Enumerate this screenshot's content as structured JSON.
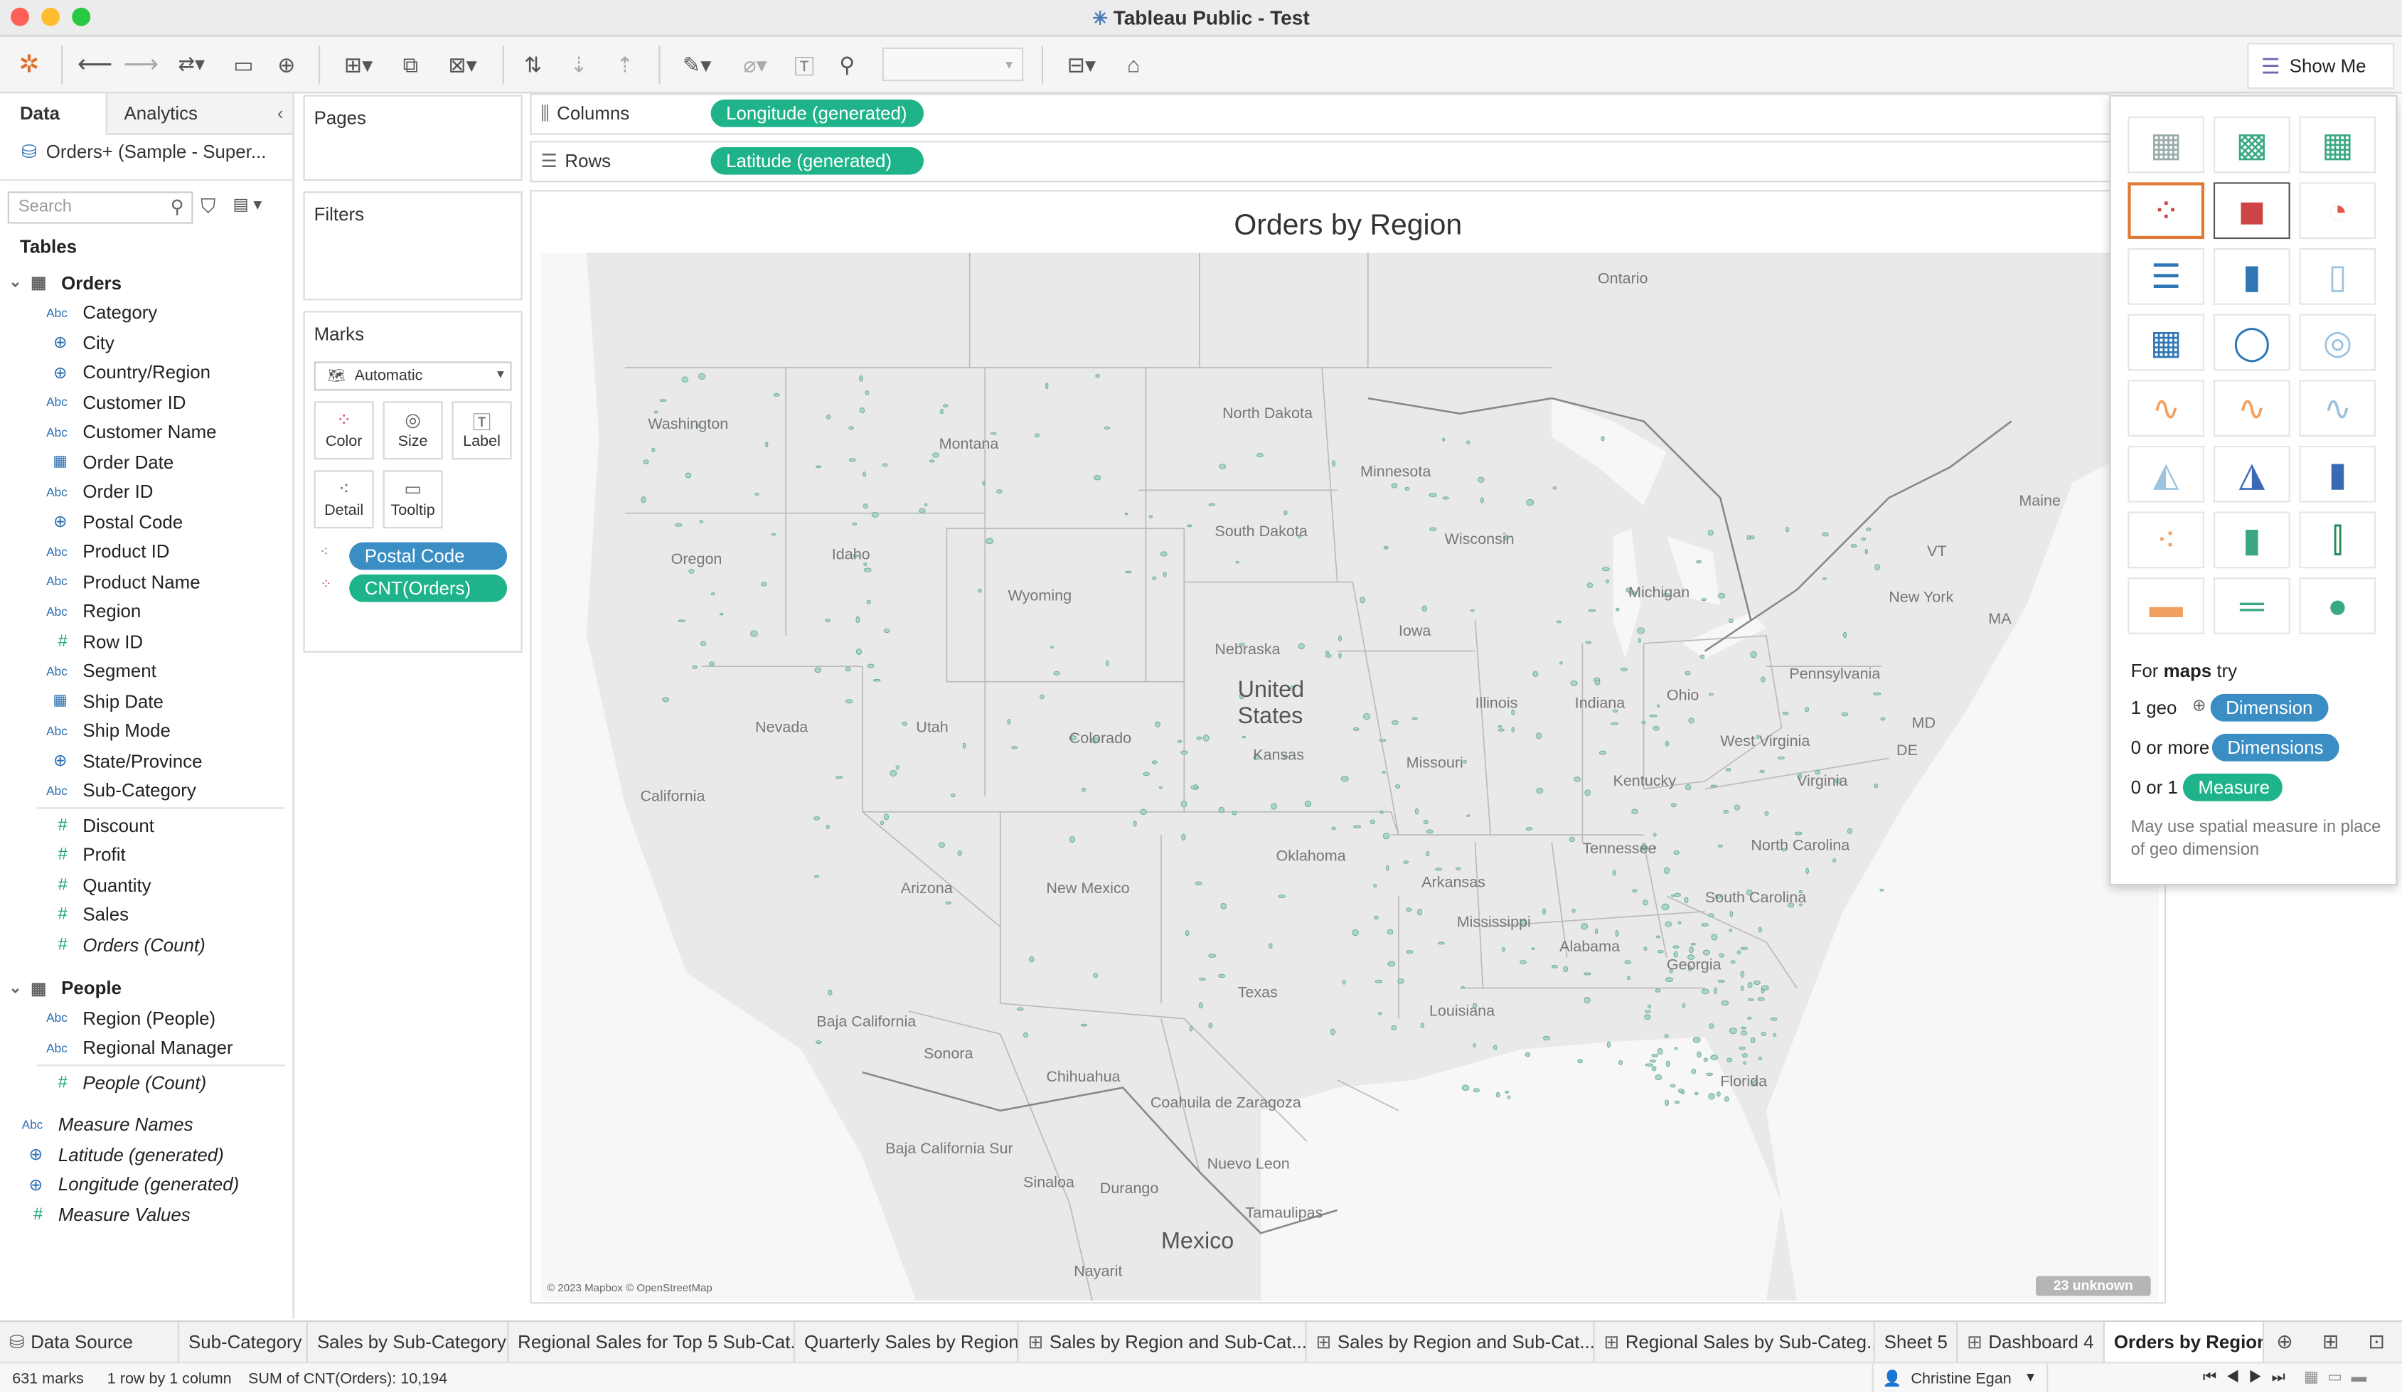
{
  "window": {
    "title": "Tableau Public - Test"
  },
  "toolbar": {
    "show_me_label": "Show Me"
  },
  "data_pane": {
    "tabs": [
      "Data",
      "Analytics"
    ],
    "datasource": "Orders+ (Sample - Super...",
    "search_placeholder": "Search",
    "tables_header": "Tables",
    "orders_table": "Orders",
    "orders_fields": [
      {
        "name": "Category",
        "type": "abc"
      },
      {
        "name": "City",
        "type": "geo"
      },
      {
        "name": "Country/Region",
        "type": "geo"
      },
      {
        "name": "Customer ID",
        "type": "abc"
      },
      {
        "name": "Customer Name",
        "type": "abc"
      },
      {
        "name": "Order Date",
        "type": "date"
      },
      {
        "name": "Order ID",
        "type": "abc"
      },
      {
        "name": "Postal Code",
        "type": "geo"
      },
      {
        "name": "Product ID",
        "type": "abc"
      },
      {
        "name": "Product Name",
        "type": "abc"
      },
      {
        "name": "Region",
        "type": "abc"
      },
      {
        "name": "Row ID",
        "type": "num"
      },
      {
        "name": "Segment",
        "type": "abc"
      },
      {
        "name": "Ship Date",
        "type": "date"
      },
      {
        "name": "Ship Mode",
        "type": "abc"
      },
      {
        "name": "State/Province",
        "type": "geo"
      },
      {
        "name": "Sub-Category",
        "type": "abc"
      }
    ],
    "orders_measures": [
      {
        "name": "Discount",
        "type": "num"
      },
      {
        "name": "Profit",
        "type": "num"
      },
      {
        "name": "Quantity",
        "type": "num"
      },
      {
        "name": "Sales",
        "type": "num"
      },
      {
        "name": "Orders (Count)",
        "type": "num",
        "italic": true
      }
    ],
    "people_table": "People",
    "people_fields": [
      {
        "name": "Region (People)",
        "type": "abc"
      },
      {
        "name": "Regional Manager",
        "type": "abc"
      }
    ],
    "people_measures": [
      {
        "name": "People (Count)",
        "type": "num",
        "italic": true
      }
    ],
    "generated_fields": [
      {
        "name": "Measure Names",
        "type": "abc",
        "italic": true
      },
      {
        "name": "Latitude (generated)",
        "type": "geo",
        "italic": true
      },
      {
        "name": "Longitude (generated)",
        "type": "geo",
        "italic": true
      },
      {
        "name": "Measure Values",
        "type": "num",
        "italic": true
      }
    ]
  },
  "cards": {
    "pages": "Pages",
    "filters": "Filters",
    "marks": "Marks",
    "mark_type": "Automatic",
    "mark_buttons": [
      "Color",
      "Size",
      "Label",
      "Detail",
      "Tooltip"
    ],
    "mark_pills": [
      "Postal Code",
      "CNT(Orders)"
    ]
  },
  "shelves": {
    "columns_label": "Columns",
    "columns_pill": "Longitude (generated)",
    "rows_label": "Rows",
    "rows_pill": "Latitude (generated)"
  },
  "view": {
    "title": "Orders by Region",
    "attribution": "© 2023 Mapbox © OpenStreetMap",
    "unknown_badge": "23 unknown",
    "map_labels": [
      {
        "t": "Ontario"
      },
      {
        "t": "Washington"
      },
      {
        "t": "Montana"
      },
      {
        "t": "North Dakota"
      },
      {
        "t": "Minnesota"
      },
      {
        "t": "Maine"
      },
      {
        "t": "South Dakota"
      },
      {
        "t": "Wisconsin"
      },
      {
        "t": "Oregon"
      },
      {
        "t": "Idaho"
      },
      {
        "t": "Wyoming"
      },
      {
        "t": "Michigan"
      },
      {
        "t": "VT"
      },
      {
        "t": "New York"
      },
      {
        "t": "MA"
      },
      {
        "t": "Iowa"
      },
      {
        "t": "Nebraska"
      },
      {
        "t": "Pennsylvania"
      },
      {
        "t": "United States"
      },
      {
        "t": "Illinois"
      },
      {
        "t": "Indiana"
      },
      {
        "t": "Ohio"
      },
      {
        "t": "Nevada"
      },
      {
        "t": "Utah"
      },
      {
        "t": "Colorado"
      },
      {
        "t": "Kansas"
      },
      {
        "t": "MD"
      },
      {
        "t": "West Virginia"
      },
      {
        "t": "DE"
      },
      {
        "t": "Missouri"
      },
      {
        "t": "Virginia"
      },
      {
        "t": "Kentucky"
      },
      {
        "t": "California"
      },
      {
        "t": "Tennessee"
      },
      {
        "t": "North Carolina"
      },
      {
        "t": "Oklahoma"
      },
      {
        "t": "Arizona"
      },
      {
        "t": "New Mexico"
      },
      {
        "t": "Arkansas"
      },
      {
        "t": "South Carolina"
      },
      {
        "t": "Mississippi"
      },
      {
        "t": "Alabama"
      },
      {
        "t": "Georgia"
      },
      {
        "t": "Texas"
      },
      {
        "t": "Louisiana"
      },
      {
        "t": "Baja California"
      },
      {
        "t": "Sonora"
      },
      {
        "t": "Chihuahua"
      },
      {
        "t": "Florida"
      },
      {
        "t": "Coahuila de Zaragoza"
      },
      {
        "t": "Baja California Sur"
      },
      {
        "t": "Nuevo Leon"
      },
      {
        "t": "Sinaloa"
      },
      {
        "t": "Durango"
      },
      {
        "t": "Tamaulipas"
      },
      {
        "t": "Mexico"
      },
      {
        "t": "Nayarit"
      }
    ]
  },
  "show_me": {
    "hint_prefix": "For",
    "hint_bold": "maps",
    "hint_suffix": "try",
    "rows": [
      {
        "label": "1 geo",
        "pill": "Dimension"
      },
      {
        "label": "0 or more",
        "pill": "Dimensions"
      },
      {
        "label": "0 or 1",
        "pill": "Measure"
      }
    ],
    "note": "May use spatial measure in place of geo dimension"
  },
  "sheet_tabs": [
    "Data Source",
    "Sub-Category",
    "Sales by Sub-Category",
    "Regional Sales for Top 5 Sub-Cat...",
    "Quarterly Sales by Region",
    "Sales by Region and Sub-Cat...",
    "Sales by Region and Sub-Cat...",
    "Regional Sales by Sub-Categ...",
    "Sheet 5",
    "Dashboard 4",
    "Orders by Region"
  ],
  "status": {
    "marks": "631 marks",
    "dims": "1 row by 1 column",
    "sum": "SUM of CNT(Orders): 10,194",
    "user": "Christine Egan"
  },
  "colors": {
    "accent_green": "#1fb38a",
    "pill_blue": "#3a8ec3",
    "map_region": "#a8d5c4"
  }
}
